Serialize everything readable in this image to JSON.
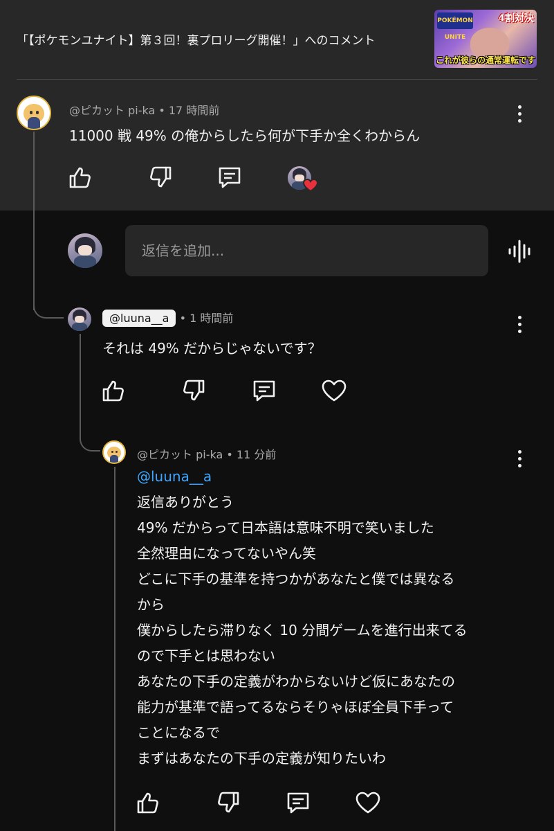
{
  "header": {
    "title": "「【ポケモンユナイト】第３回！裏プロリーグ開催！」へのコメント",
    "thumbnail": {
      "badge": "POKÉMON UNITE",
      "corner": "4割対決",
      "caption": "これが彼らの通常運転です"
    }
  },
  "comment": {
    "author": "@ピカット pi-ka",
    "time": "17 時間前",
    "text": "11000 戦 49% の俺からしたら何が下手か全くわからん",
    "icons": [
      "like-icon",
      "dislike-icon",
      "reply-icon",
      "creator-heart-icon"
    ]
  },
  "reply_box": {
    "placeholder": "返信を追加...",
    "mic_icon": "voice-icon"
  },
  "reply1": {
    "author": "@luuna__a",
    "time": "1 時間前",
    "text": "それは 49% だからじゃないです？",
    "icons": [
      "like-icon",
      "dislike-icon",
      "reply-icon",
      "heart-icon"
    ]
  },
  "reply2": {
    "author": "@ピカット pi-ka",
    "time": "11 分前",
    "mention": "@luuna__a",
    "lines": [
      "返信ありがとう",
      "49% だからって日本語は意味不明で笑いました",
      "全然理由になってないやん笑",
      "どこに下手の基準を持つかがあなたと僕では異なる",
      "から",
      "僕からしたら滞りなく 10 分間ゲームを進行出来てる",
      "ので下手とは思わない",
      "あなたの下手の定義がわからないけど仮にあなたの",
      "能力が基準で語ってるならそりゃほぼ全員下手って",
      "ことになるで",
      "まずはあなたの下手の定義が知りたいわ"
    ],
    "icons": [
      "like-icon",
      "dislike-icon",
      "reply-icon",
      "heart-icon"
    ]
  },
  "colors": {
    "background": "#0f0f0f",
    "highlight": "#282828",
    "link": "#3ea6ff",
    "heart": "#e8313c"
  }
}
